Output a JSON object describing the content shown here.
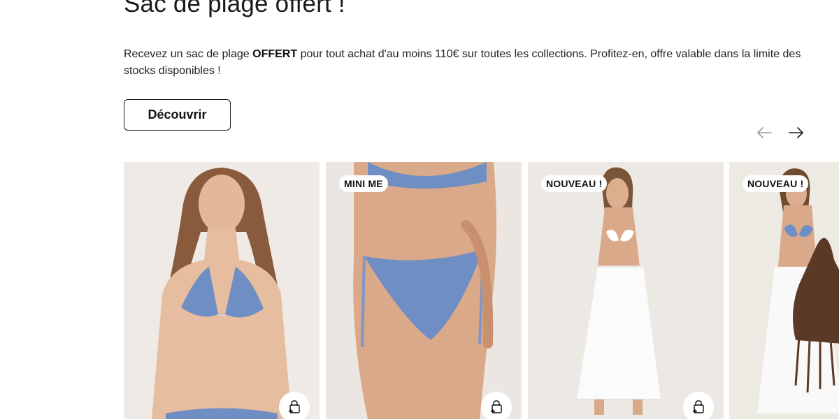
{
  "header": {
    "title": "Sac de plage offert !",
    "promo_before": "Recevez un sac de plage ",
    "promo_bold": "OFFERT",
    "promo_after": " pour tout achat d'au moins 110€ sur toutes les collections. Profitez-en, offre valable dans la limite des stocks disponibles !",
    "cta_label": "Découvrir"
  },
  "carousel": {
    "prev_icon": "arrow-left-icon",
    "next_icon": "arrow-right-icon",
    "cards": [
      {
        "badge": "",
        "image": "model-in-blue-triangle-bikini",
        "action_icon": "add-to-bag-icon"
      },
      {
        "badge": "MINI ME",
        "image": "blue-patterned-bikini-bottom-closeup",
        "action_icon": "add-to-bag-icon"
      },
      {
        "badge": "NOUVEAU !",
        "image": "model-white-bikini-top-and-white-maxi-skirt",
        "action_icon": "add-to-bag-icon"
      },
      {
        "badge": "NOUVEAU !",
        "image": "model-with-brown-fringe-bag-and-white-skirt",
        "action_icon": "add-to-bag-icon"
      }
    ]
  },
  "colors": {
    "text": "#1a1a1a",
    "background": "#ffffff",
    "arrow_disabled": "#9a9a9a",
    "arrow_active": "#1a1a1a",
    "bikini_blue": "#6f8fc4",
    "photo_backdrop": "#ece7e2"
  }
}
